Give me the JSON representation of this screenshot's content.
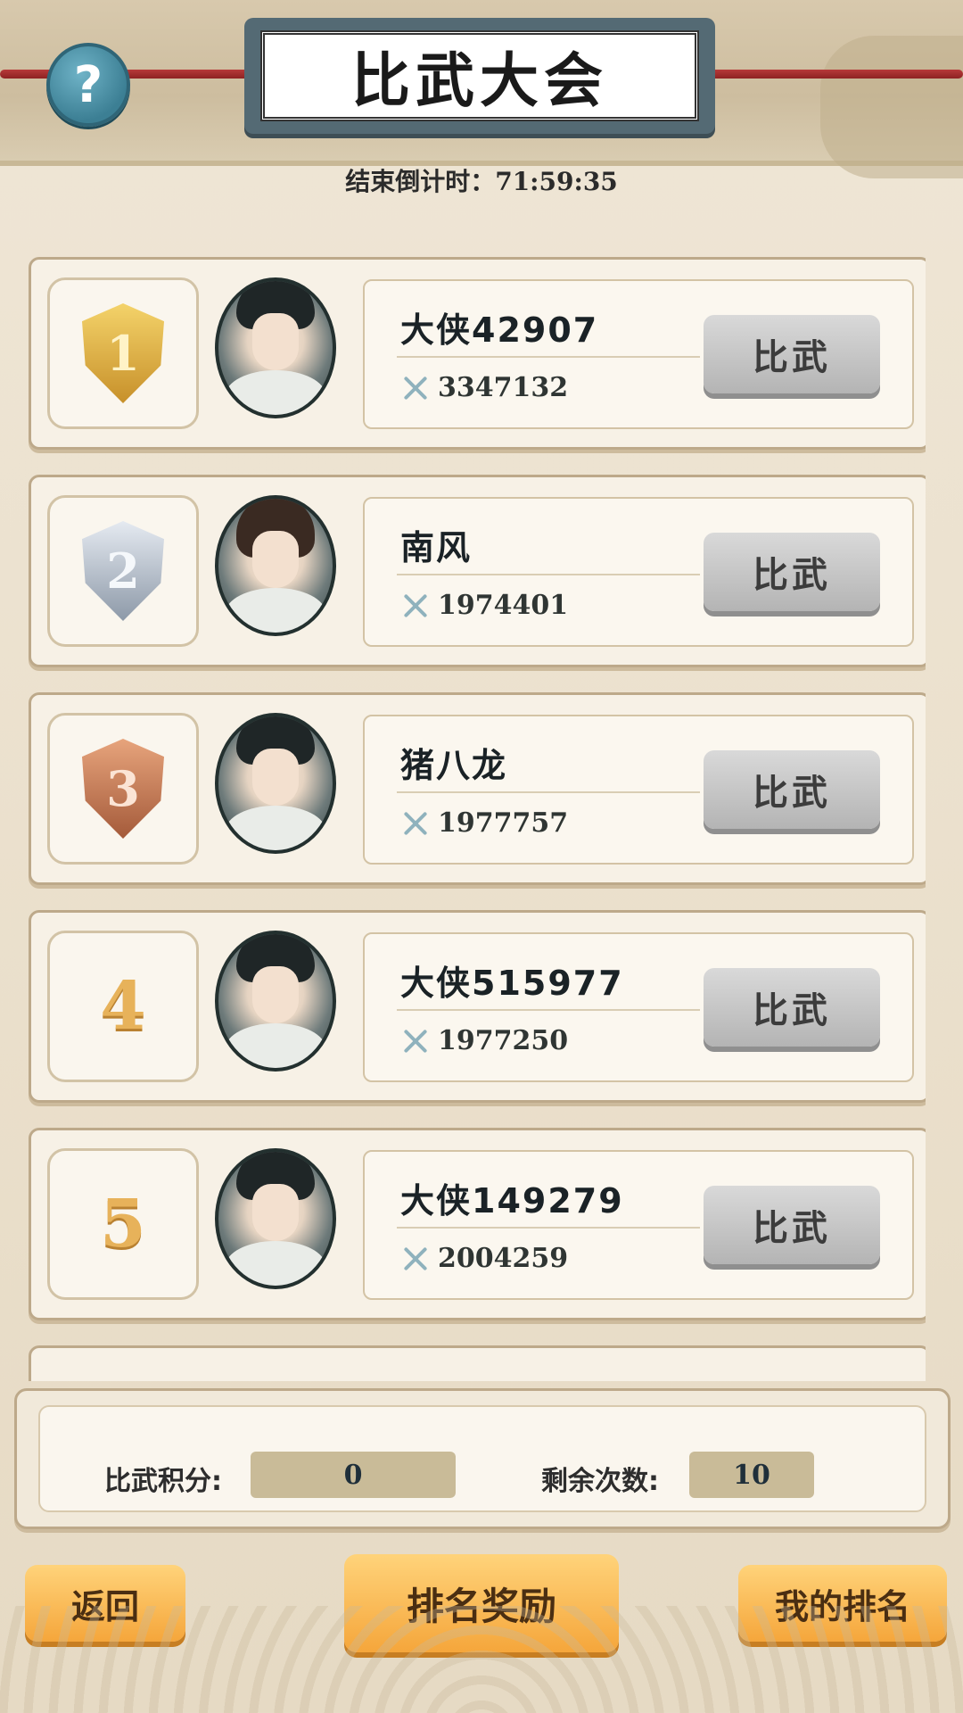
{
  "header": {
    "title": "比武大会",
    "countdown_label": "结束倒计时：",
    "countdown_value": "71:59:35"
  },
  "icons": {
    "help": "help-icon",
    "power": "crossed-swords-icon"
  },
  "players": [
    {
      "rank": "1",
      "medal": "gold",
      "name": "大侠42907",
      "power": "3347132",
      "action": "比武"
    },
    {
      "rank": "2",
      "medal": "silver",
      "name": "南风",
      "power": "1974401",
      "action": "比武"
    },
    {
      "rank": "3",
      "medal": "bronze",
      "name": "猪八龙",
      "power": "1977757",
      "action": "比武"
    },
    {
      "rank": "4",
      "medal": "",
      "name": "大侠515977",
      "power": "1977250",
      "action": "比武"
    },
    {
      "rank": "5",
      "medal": "",
      "name": "大侠149279",
      "power": "2004259",
      "action": "比武"
    }
  ],
  "stats": {
    "score_label": "比武积分:",
    "score_value": "0",
    "remaining_label": "剩余次数:",
    "remaining_value": "10"
  },
  "buttons": {
    "back": "返回",
    "rank_reward": "排名奖励",
    "my_rank": "我的排名"
  },
  "colors": {
    "accent_orange": "#f5a63b",
    "title_plaque": "#546a74",
    "rope_red": "#b73a3a"
  }
}
